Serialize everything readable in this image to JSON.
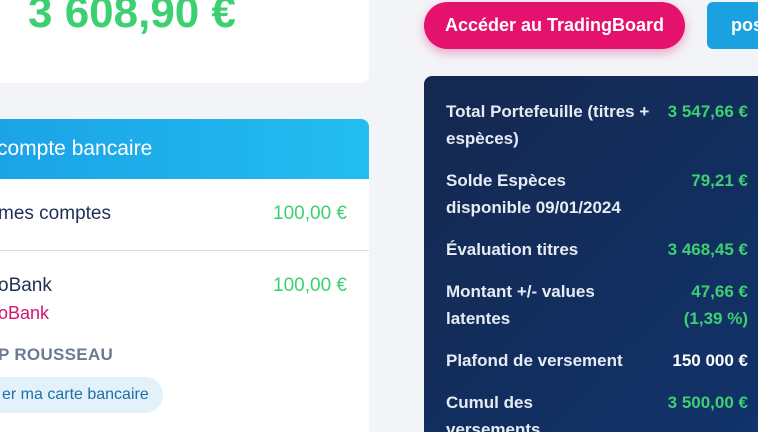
{
  "balance": {
    "amount": "3 608,90 €"
  },
  "bank_card": {
    "title": "compte bancaire",
    "accounts_label": "mes comptes",
    "accounts_amount": "100,00 €",
    "bank_name": "oBank",
    "bank_amount": "100,00 €",
    "bank_sub": "oBank",
    "holder": "P ROUSSEAU",
    "card_button": "er ma carte bancaire"
  },
  "buttons": {
    "tradingboard": "Accéder au TradingBoard",
    "pos": "pos"
  },
  "summary": {
    "rows": [
      {
        "label": "Total Portefeuille (titres + espèces)",
        "value": "3 547,66 €"
      },
      {
        "label": "Solde Espèces disponible 09/01/2024",
        "value": "79,21 €"
      },
      {
        "label": "Évaluation titres",
        "value": "3 468,45 €"
      },
      {
        "label": "Montant +/- values latentes",
        "value": "47,66 €",
        "value2": "(1,39 %)"
      },
      {
        "label": "Plafond de versement",
        "value": "150 000 €"
      },
      {
        "label": "Cumul des versements",
        "value": "3 500,00 €"
      }
    ]
  },
  "colors": {
    "green": "#3dd071",
    "pink": "#e4126d",
    "blue": "#1ca1e0",
    "navy": "#14284f"
  }
}
